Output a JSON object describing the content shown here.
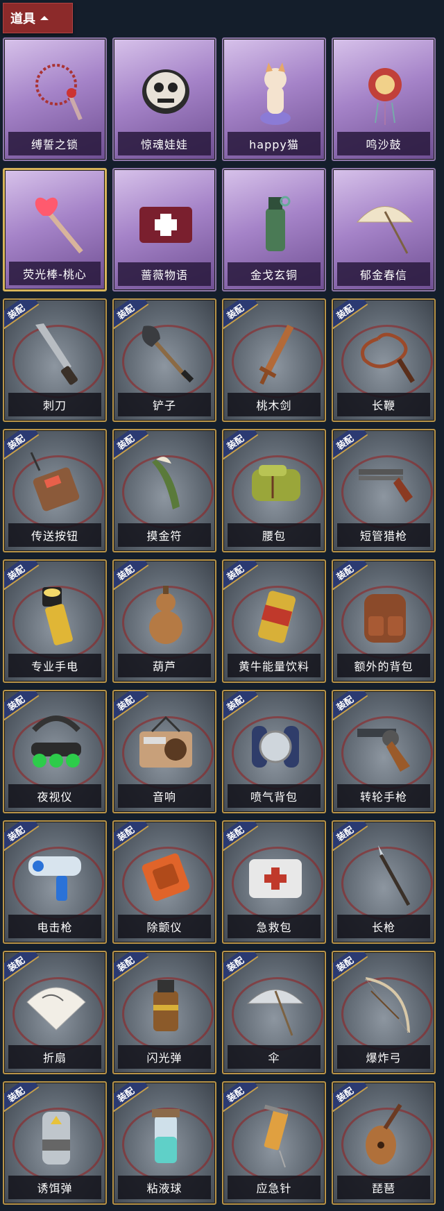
{
  "header": {
    "title": "道具"
  },
  "badge_label": "装配",
  "items": [
    {
      "name": "缚誓之锁",
      "type": "prop",
      "icon": "chain-lock-icon",
      "selected": false
    },
    {
      "name": "惊魂娃娃",
      "type": "prop",
      "icon": "doll-mask-icon",
      "selected": false
    },
    {
      "name": "happy猫",
      "type": "prop",
      "icon": "cat-figure-icon",
      "selected": false
    },
    {
      "name": "鸣沙鼓",
      "type": "prop",
      "icon": "drum-charm-icon",
      "selected": false
    },
    {
      "name": "荧光棒-桃心",
      "type": "prop",
      "icon": "heart-wand-icon",
      "selected": true
    },
    {
      "name": "蔷薇物语",
      "type": "prop",
      "icon": "medkit-box-icon",
      "selected": false
    },
    {
      "name": "金戈玄铜",
      "type": "prop",
      "icon": "bronze-grenade-icon",
      "selected": false
    },
    {
      "name": "郁金春信",
      "type": "prop",
      "icon": "paper-umbrella-icon",
      "selected": false
    },
    {
      "name": "刺刀",
      "type": "gear",
      "icon": "bayonet-icon"
    },
    {
      "name": "铲子",
      "type": "gear",
      "icon": "shovel-icon"
    },
    {
      "name": "桃木剑",
      "type": "gear",
      "icon": "wooden-sword-icon"
    },
    {
      "name": "长鞭",
      "type": "gear",
      "icon": "whip-icon"
    },
    {
      "name": "传送按钮",
      "type": "gear",
      "icon": "teleport-remote-icon"
    },
    {
      "name": "摸金符",
      "type": "gear",
      "icon": "amulet-icon"
    },
    {
      "name": "腰包",
      "type": "gear",
      "icon": "waist-bag-icon"
    },
    {
      "name": "短管猎枪",
      "type": "gear",
      "icon": "shotgun-icon"
    },
    {
      "name": "专业手电",
      "type": "gear",
      "icon": "flashlight-icon"
    },
    {
      "name": "葫芦",
      "type": "gear",
      "icon": "gourd-icon"
    },
    {
      "name": "黄牛能量饮料",
      "type": "gear",
      "icon": "energy-drink-icon"
    },
    {
      "name": "额外的背包",
      "type": "gear",
      "icon": "backpack-icon"
    },
    {
      "name": "夜视仪",
      "type": "gear",
      "icon": "night-vision-icon"
    },
    {
      "name": "音响",
      "type": "gear",
      "icon": "radio-speaker-icon"
    },
    {
      "name": "喷气背包",
      "type": "gear",
      "icon": "jetpack-icon"
    },
    {
      "name": "转轮手枪",
      "type": "gear",
      "icon": "revolver-icon"
    },
    {
      "name": "电击枪",
      "type": "gear",
      "icon": "stun-gun-icon"
    },
    {
      "name": "除颤仪",
      "type": "gear",
      "icon": "defibrillator-icon"
    },
    {
      "name": "急救包",
      "type": "gear",
      "icon": "first-aid-kit-icon"
    },
    {
      "name": "长枪",
      "type": "gear",
      "icon": "spear-icon"
    },
    {
      "name": "折扇",
      "type": "gear",
      "icon": "folding-fan-icon"
    },
    {
      "name": "闪光弹",
      "type": "gear",
      "icon": "flashbang-icon"
    },
    {
      "name": "伞",
      "type": "gear",
      "icon": "umbrella-icon"
    },
    {
      "name": "爆炸弓",
      "type": "gear",
      "icon": "bow-icon"
    },
    {
      "name": "诱饵弹",
      "type": "gear",
      "icon": "decoy-grenade-icon"
    },
    {
      "name": "粘液球",
      "type": "gear",
      "icon": "slime-vial-icon"
    },
    {
      "name": "应急针",
      "type": "gear",
      "icon": "syringe-icon"
    },
    {
      "name": "琵琶",
      "type": "gear",
      "icon": "pipa-icon"
    }
  ]
}
